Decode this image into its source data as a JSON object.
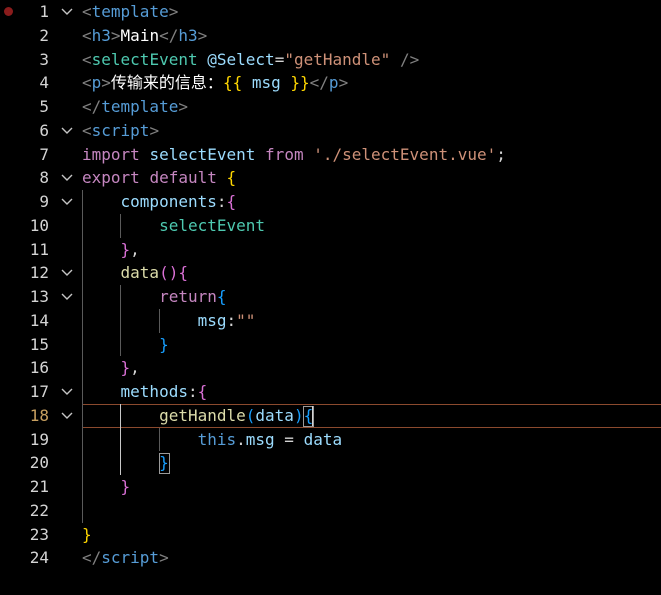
{
  "editor": {
    "active_line": 18,
    "breakpoint_line": 1,
    "lines": [
      {
        "n": "1",
        "fold": true,
        "tokens": [
          [
            "t-brk",
            "<"
          ],
          [
            "t-tag",
            "template"
          ],
          [
            "t-brk",
            ">"
          ]
        ]
      },
      {
        "n": "2",
        "fold": false,
        "tokens": [
          [
            "t-brk",
            "<"
          ],
          [
            "t-tag",
            "h3"
          ],
          [
            "t-brk",
            ">"
          ],
          [
            "t-txt",
            "Main"
          ],
          [
            "t-brk",
            "</"
          ],
          [
            "t-tag",
            "h3"
          ],
          [
            "t-brk",
            ">"
          ]
        ]
      },
      {
        "n": "3",
        "fold": false,
        "tokens": [
          [
            "t-brk",
            "<"
          ],
          [
            "t-cls",
            "selectEvent"
          ],
          [
            "t-w",
            " "
          ],
          [
            "t-attr",
            "@Select"
          ],
          [
            "t-w",
            "="
          ],
          [
            "t-str",
            "\"getHandle\""
          ],
          [
            "t-w",
            " "
          ],
          [
            "t-brk",
            "/>"
          ]
        ]
      },
      {
        "n": "4",
        "fold": false,
        "tokens": [
          [
            "t-brk",
            "<"
          ],
          [
            "t-tag",
            "p"
          ],
          [
            "t-brk",
            ">"
          ],
          [
            "t-txt",
            "传输来的信息："
          ],
          [
            "t-p1",
            "{{"
          ],
          [
            "t-w",
            " "
          ],
          [
            "t-var",
            "msg"
          ],
          [
            "t-w",
            " "
          ],
          [
            "t-p1",
            "}}"
          ],
          [
            "t-brk",
            "</"
          ],
          [
            "t-tag",
            "p"
          ],
          [
            "t-brk",
            ">"
          ]
        ]
      },
      {
        "n": "5",
        "fold": false,
        "tokens": [
          [
            "t-brk",
            "</"
          ],
          [
            "t-tag",
            "template"
          ],
          [
            "t-brk",
            ">"
          ]
        ]
      },
      {
        "n": "6",
        "fold": true,
        "tokens": [
          [
            "t-brk",
            "<"
          ],
          [
            "t-tag",
            "script"
          ],
          [
            "t-brk",
            ">"
          ]
        ]
      },
      {
        "n": "7",
        "fold": false,
        "tokens": [
          [
            "t-kw",
            "import"
          ],
          [
            "t-w",
            " "
          ],
          [
            "t-var",
            "selectEvent"
          ],
          [
            "t-w",
            " "
          ],
          [
            "t-kw",
            "from"
          ],
          [
            "t-w",
            " "
          ],
          [
            "t-str",
            "'./selectEvent.vue'"
          ],
          [
            "t-w",
            ";"
          ]
        ]
      },
      {
        "n": "8",
        "fold": true,
        "tokens": [
          [
            "t-kw",
            "export"
          ],
          [
            "t-w",
            " "
          ],
          [
            "t-kw",
            "default"
          ],
          [
            "t-w",
            " "
          ],
          [
            "t-p1",
            "{"
          ]
        ]
      },
      {
        "n": "9",
        "fold": true,
        "tokens": [
          [
            "t-w",
            "    "
          ],
          [
            "t-var",
            "components"
          ],
          [
            "t-w",
            ":"
          ],
          [
            "t-p2",
            "{"
          ]
        ]
      },
      {
        "n": "10",
        "fold": false,
        "tokens": [
          [
            "t-w",
            "        "
          ],
          [
            "t-cls",
            "selectEvent"
          ]
        ]
      },
      {
        "n": "11",
        "fold": false,
        "tokens": [
          [
            "t-w",
            "    "
          ],
          [
            "t-p2",
            "}"
          ],
          [
            "t-w",
            ","
          ]
        ]
      },
      {
        "n": "12",
        "fold": true,
        "tokens": [
          [
            "t-w",
            "    "
          ],
          [
            "t-fn",
            "data"
          ],
          [
            "t-p2",
            "()"
          ],
          [
            "t-p2",
            "{"
          ]
        ]
      },
      {
        "n": "13",
        "fold": true,
        "tokens": [
          [
            "t-w",
            "        "
          ],
          [
            "t-kw",
            "return"
          ],
          [
            "t-p3",
            "{"
          ]
        ]
      },
      {
        "n": "14",
        "fold": false,
        "tokens": [
          [
            "t-w",
            "            "
          ],
          [
            "t-var",
            "msg"
          ],
          [
            "t-w",
            ":"
          ],
          [
            "t-str",
            "\"\""
          ]
        ]
      },
      {
        "n": "15",
        "fold": false,
        "tokens": [
          [
            "t-w",
            "        "
          ],
          [
            "t-p3",
            "}"
          ]
        ]
      },
      {
        "n": "16",
        "fold": false,
        "tokens": [
          [
            "t-w",
            "    "
          ],
          [
            "t-p2",
            "}"
          ],
          [
            "t-w",
            ","
          ]
        ]
      },
      {
        "n": "17",
        "fold": true,
        "tokens": [
          [
            "t-w",
            "    "
          ],
          [
            "t-var",
            "methods"
          ],
          [
            "t-w",
            ":"
          ],
          [
            "t-p2",
            "{"
          ]
        ]
      },
      {
        "n": "18",
        "fold": true,
        "tokens": [
          [
            "t-w",
            "        "
          ],
          [
            "t-fn",
            "getHandle"
          ],
          [
            "t-p3",
            "("
          ],
          [
            "t-var",
            "data"
          ],
          [
            "t-p3",
            ")"
          ],
          [
            "t-p3",
            "{"
          ]
        ]
      },
      {
        "n": "19",
        "fold": false,
        "tokens": [
          [
            "t-w",
            "            "
          ],
          [
            "t-kw2",
            "this"
          ],
          [
            "t-w",
            "."
          ],
          [
            "t-var",
            "msg"
          ],
          [
            "t-w",
            " = "
          ],
          [
            "t-var",
            "data"
          ]
        ]
      },
      {
        "n": "20",
        "fold": false,
        "tokens": [
          [
            "t-w",
            "        "
          ],
          [
            "t-p3",
            "}"
          ]
        ]
      },
      {
        "n": "21",
        "fold": false,
        "tokens": [
          [
            "t-w",
            "    "
          ],
          [
            "t-p2",
            "}"
          ]
        ]
      },
      {
        "n": "22",
        "fold": false,
        "tokens": []
      },
      {
        "n": "23",
        "fold": false,
        "tokens": [
          [
            "t-p1",
            "}"
          ]
        ]
      },
      {
        "n": "24",
        "fold": false,
        "tokens": [
          [
            "t-brk",
            "</"
          ],
          [
            "t-tag",
            "script"
          ],
          [
            "t-brk",
            ">"
          ]
        ]
      }
    ]
  }
}
